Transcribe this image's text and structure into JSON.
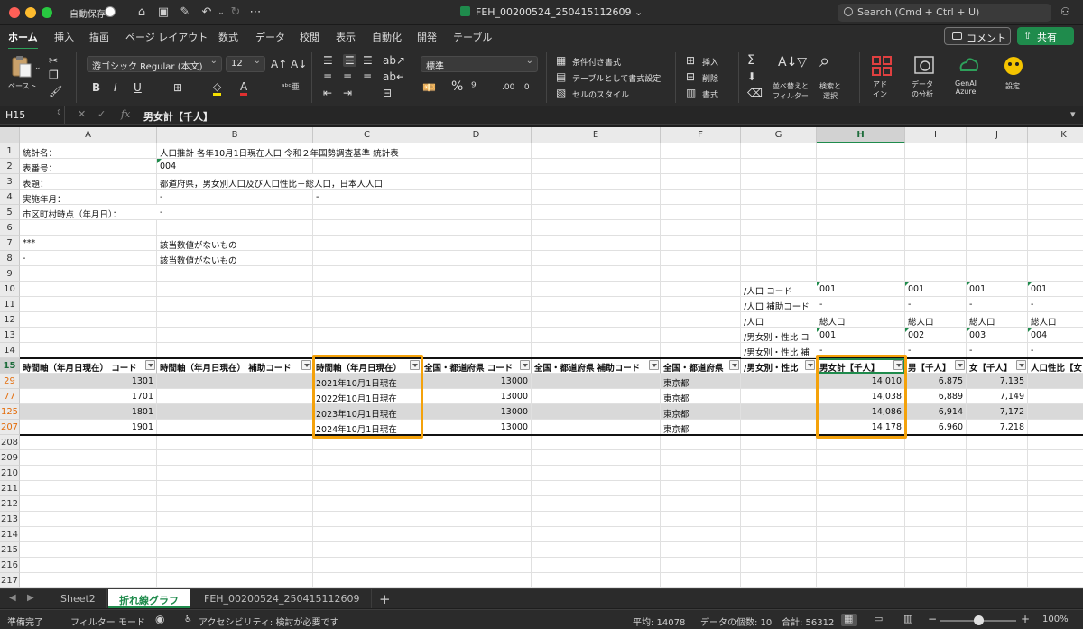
{
  "titlebar": {
    "autosave_label": "自動保存",
    "doc_title": "FEH_00200524_250415112609 ⌄",
    "search_placeholder": "Search (Cmd + Ctrl + U)"
  },
  "ribbon_tabs": [
    "ホーム",
    "挿入",
    "描画",
    "ページ レイアウト",
    "数式",
    "データ",
    "校閲",
    "表示",
    "自動化",
    "開発",
    "テーブル"
  ],
  "buttons": {
    "comment": "コメント",
    "share": "共有"
  },
  "ribbon": {
    "paste": "ペースト",
    "font_name": "游ゴシック Regular (本文)",
    "font_size": "12",
    "number_format": "標準",
    "conditional_format": "条件付き書式",
    "format_as_table": "テーブルとして書式設定",
    "cell_styles": "セルのスタイル",
    "insert": "挿入",
    "delete": "削除",
    "format": "書式",
    "sort_filter": "並べ替えと\nフィルター",
    "find_select": "検索と\n選択",
    "addins": "アド\nイン",
    "analyze": "データ\nの分析",
    "genai": "GenAI\nAzure",
    "settings": "設定"
  },
  "formula_bar": {
    "cell_ref": "H15",
    "fx": "fx",
    "content": "男女計【千人】"
  },
  "columns": [
    "A",
    "B",
    "C",
    "D",
    "E",
    "F",
    "G",
    "H",
    "I",
    "J",
    "K"
  ],
  "selected_column": "H",
  "rows": {
    "r1": {
      "num": "1",
      "A": "統計名：",
      "B": "人口推計 各年10月1日現在人口 令和２年国勢調査基準 統計表"
    },
    "r2": {
      "num": "2",
      "A": "表番号：",
      "B": "004"
    },
    "r3": {
      "num": "3",
      "A": "表題：",
      "B": "都道府県，男女別人口及び人口性比－総人口，日本人人口"
    },
    "r4": {
      "num": "4",
      "A": "実施年月：",
      "B": "-",
      "C": "-"
    },
    "r5": {
      "num": "5",
      "A": "市区町村時点（年月日）：",
      "B": "-"
    },
    "r6": {
      "num": "6"
    },
    "r7": {
      "num": "7",
      "A": "***",
      "B": "該当数値がないもの"
    },
    "r8": {
      "num": "8",
      "A": "-",
      "B": "該当数値がないもの"
    },
    "r9": {
      "num": "9"
    },
    "r10": {
      "num": "10",
      "G": "/人口 コード",
      "H": "001",
      "I": "001",
      "J": "001",
      "K": "001"
    },
    "r11": {
      "num": "11",
      "G": "/人口 補助コード",
      "H": "-",
      "I": "-",
      "J": "-",
      "K": "-"
    },
    "r12": {
      "num": "12",
      "G": "/人口",
      "H": "総人口",
      "I": "総人口",
      "J": "総人口",
      "K": "総人口"
    },
    "r13": {
      "num": "13",
      "G": "/男女別・性比 コ",
      "H": "001",
      "I": "002",
      "J": "003",
      "K": "004"
    },
    "r14": {
      "num": "14",
      "G": "/男女別・性比 補",
      "H": "-",
      "I": "-",
      "J": "-",
      "K": "-"
    }
  },
  "header_row": {
    "num": "15",
    "A": "時間軸（年月日現在） コード",
    "B": "時間軸（年月日現在） 補助コード",
    "C": "時間軸（年月日現在）",
    "D": "全国・都道府県 コード",
    "E": "全国・都道府県 補助コード",
    "F": "全国・都道府県",
    "G": "/男女別・性比",
    "H": "男女計【千人】",
    "I": "男【千人】",
    "J": "女【千人】",
    "K": "人口性比【女"
  },
  "data_rows": [
    {
      "num": "29",
      "A": "1301",
      "C": "2021年10月1日現在",
      "D": "13000",
      "F": "東京都",
      "H": "14,010",
      "I": "6,875",
      "J": "7,135"
    },
    {
      "num": "77",
      "A": "1701",
      "C": "2022年10月1日現在",
      "D": "13000",
      "F": "東京都",
      "H": "14,038",
      "I": "6,889",
      "J": "7,149"
    },
    {
      "num": "125",
      "A": "1801",
      "C": "2023年10月1日現在",
      "D": "13000",
      "F": "東京都",
      "H": "14,086",
      "I": "6,914",
      "J": "7,172"
    },
    {
      "num": "207",
      "A": "1901",
      "C": "2024年10月1日現在",
      "D": "13000",
      "F": "東京都",
      "H": "14,178",
      "I": "6,960",
      "J": "7,218"
    }
  ],
  "empty_rows": [
    "208",
    "209",
    "210",
    "211",
    "212",
    "213",
    "214",
    "215",
    "216",
    "217"
  ],
  "sheet_tabs": [
    "Sheet2",
    "折れ線グラフ",
    "FEH_00200524_250415112609"
  ],
  "active_sheet_index": 1,
  "statusbar": {
    "ready": "準備完了",
    "filter_mode": "フィルター モード",
    "accessibility": "アクセシビリティ: 検討が必要です",
    "average": "平均: 14078",
    "count": "データの個数: 10",
    "sum": "合計: 56312",
    "zoom": "100%",
    "zoom_value": 1.0
  },
  "colors": {
    "accent_green": "#1f8b4c",
    "highlight_orange": "#f4a20b",
    "filtered_row": "#e36c0a"
  }
}
